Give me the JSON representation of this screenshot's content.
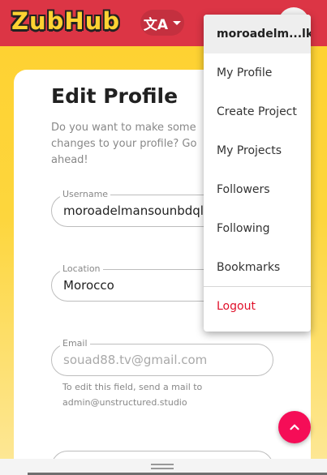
{
  "header": {
    "logo_text": "ZubHub",
    "lang_icon_glyph": "文A",
    "lang_icon": "translate-icon"
  },
  "page": {
    "title": "Edit Profile",
    "subtitle": "Do you want to make some changes to your profile? Go ahead!"
  },
  "form": {
    "username": {
      "label": "Username",
      "value": "moroadelmansounbdqlk"
    },
    "location": {
      "label": "Location",
      "value": "Morocco"
    },
    "email": {
      "label": "Email",
      "value": "souad88.tv@gmail.com",
      "helper": "To edit this field, send a mail to admin@unstructured.studio"
    }
  },
  "menu": {
    "username": "moroadelm...lk",
    "items": [
      "My Profile",
      "Create Project",
      "My Projects",
      "Followers",
      "Following",
      "Bookmarks"
    ],
    "logout": "Logout"
  },
  "colors": {
    "appbar": "#dc3545",
    "brand_yellow": "#fed232",
    "fab": "#f50d57",
    "logout": "#e0102a"
  }
}
